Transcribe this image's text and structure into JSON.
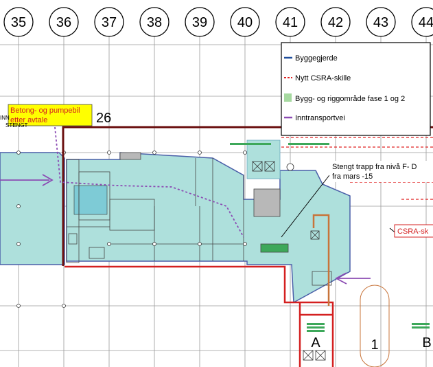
{
  "grid_axes": [
    "35",
    "36",
    "37",
    "38",
    "39",
    "40",
    "41",
    "42",
    "43",
    "44"
  ],
  "legend": {
    "items": [
      {
        "label": "Byggegjerde",
        "color": "#1f4e9c",
        "style": "solid-line"
      },
      {
        "label": "Nytt CSRA-skille",
        "color": "#e02020",
        "style": "dashed-line"
      },
      {
        "label": "Bygg- og riggområde fase 1 og 2",
        "color": "#a6d9a0",
        "style": "fill-swatch"
      },
      {
        "label": "Inntransportvei",
        "color": "#8b4bb3",
        "style": "solid-line"
      }
    ]
  },
  "annotations": {
    "concrete_note_line1": "Betong- og pumpebil",
    "concrete_note_line2": "etter avtale",
    "closed_left_1": "INN",
    "closed_left_2": "STENGT",
    "closed_stair_line1": "Stengt trapp fra nivå  F- D",
    "closed_stair_line2": "fra mars -15",
    "csra_callout": "CSRA-sk",
    "number_26": "26",
    "label_a": "A",
    "label_1": "1",
    "label_b": "B"
  },
  "colors": {
    "area_fill": "#aee0dc",
    "area_border": "#4a5fa8",
    "boundary_red": "#d42020",
    "dark_red": "#6b1010",
    "route_purple": "#8b4bb3",
    "orange_route": "#c8743a",
    "note_bg": "#ffff00",
    "grid_line": "#888888"
  }
}
